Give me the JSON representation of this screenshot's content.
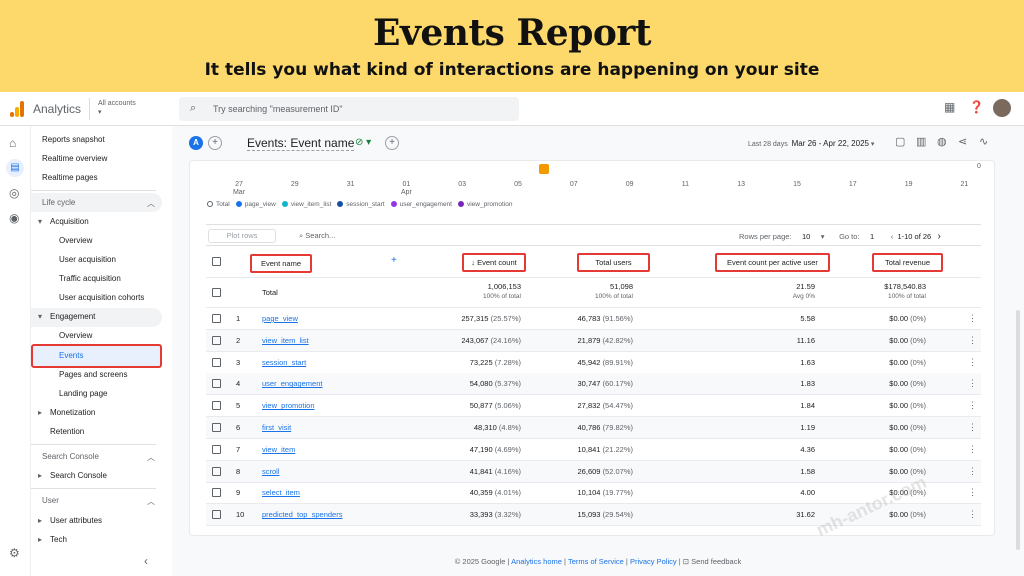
{
  "banner": {
    "title": "Events Report",
    "subtitle": "It tells you what kind of interactions are happening on your site"
  },
  "topbar": {
    "app_title": "Analytics",
    "account_label": "All accounts",
    "search_placeholder": "Try searching \"measurement ID\""
  },
  "nav": {
    "reports_snapshot": "Reports snapshot",
    "realtime_overview": "Realtime overview",
    "realtime_pages": "Realtime pages",
    "life_cycle": "Life cycle",
    "acquisition": "Acquisition",
    "acq_overview": "Overview",
    "user_acquisition": "User acquisition",
    "traffic_acquisition": "Traffic acquisition",
    "user_acq_cohorts": "User acquisition cohorts",
    "engagement": "Engagement",
    "eng_overview": "Overview",
    "events": "Events",
    "pages_screens": "Pages and screens",
    "landing_page": "Landing page",
    "monetization": "Monetization",
    "retention": "Retention",
    "search_console_sec": "Search Console",
    "search_console": "Search Console",
    "user_sec": "User",
    "user_attributes": "User attributes",
    "tech": "Tech"
  },
  "header": {
    "avatar_letter": "A",
    "title": "Events: Event name",
    "date_label": "Last 28 days",
    "date_range": "Mar 26 - Apr 22, 2025"
  },
  "chart": {
    "zero_label": "0",
    "axis": [
      {
        "d": "27",
        "m": "Mar"
      },
      {
        "d": "29",
        "m": ""
      },
      {
        "d": "31",
        "m": ""
      },
      {
        "d": "01",
        "m": "Apr"
      },
      {
        "d": "03",
        "m": ""
      },
      {
        "d": "05",
        "m": ""
      },
      {
        "d": "07",
        "m": ""
      },
      {
        "d": "09",
        "m": ""
      },
      {
        "d": "11",
        "m": ""
      },
      {
        "d": "13",
        "m": ""
      },
      {
        "d": "15",
        "m": ""
      },
      {
        "d": "17",
        "m": ""
      },
      {
        "d": "19",
        "m": ""
      },
      {
        "d": "21",
        "m": ""
      }
    ],
    "legend": [
      {
        "label": "Total",
        "color": "#ffffff"
      },
      {
        "label": "page_view",
        "color": "#1a73e8"
      },
      {
        "label": "view_item_list",
        "color": "#12b5cb"
      },
      {
        "label": "session_start",
        "color": "#174ea6"
      },
      {
        "label": "user_engagement",
        "color": "#9334e6"
      },
      {
        "label": "view_promotion",
        "color": "#7627bb"
      }
    ]
  },
  "toolbar": {
    "plot_rows": "Plot rows",
    "search": "Search...",
    "rows_per_page": "Rows per page:",
    "rows_value": "10",
    "goto": "Go to:",
    "goto_value": "1",
    "range": "1-10 of 26"
  },
  "table": {
    "headers": {
      "event_name": "Event name",
      "event_count": "Event count",
      "total_users": "Total users",
      "per_user": "Event count per active user",
      "revenue": "Total revenue"
    },
    "total": {
      "label": "Total",
      "event_count": "1,006,153",
      "event_count_sub": "100% of total",
      "users": "51,098",
      "users_sub": "100% of total",
      "per_user": "21.59",
      "per_user_sub": "Avg 0%",
      "revenue": "$178,540.83",
      "revenue_sub": "100% of total"
    },
    "rows": [
      {
        "n": "1",
        "name": "page_view",
        "count": "257,315",
        "count_pct": "(25.57%)",
        "users": "46,783",
        "users_pct": "(91.56%)",
        "per": "5.58",
        "rev": "$0.00",
        "rev_pct": "(0%)"
      },
      {
        "n": "2",
        "name": "view_item_list",
        "count": "243,067",
        "count_pct": "(24.16%)",
        "users": "21,879",
        "users_pct": "(42.82%)",
        "per": "11.16",
        "rev": "$0.00",
        "rev_pct": "(0%)"
      },
      {
        "n": "3",
        "name": "session_start",
        "count": "73,225",
        "count_pct": "(7.28%)",
        "users": "45,942",
        "users_pct": "(89.91%)",
        "per": "1.63",
        "rev": "$0.00",
        "rev_pct": "(0%)"
      },
      {
        "n": "4",
        "name": "user_engagement",
        "count": "54,080",
        "count_pct": "(5.37%)",
        "users": "30,747",
        "users_pct": "(60.17%)",
        "per": "1.83",
        "rev": "$0.00",
        "rev_pct": "(0%)"
      },
      {
        "n": "5",
        "name": "view_promotion",
        "count": "50,877",
        "count_pct": "(5.06%)",
        "users": "27,832",
        "users_pct": "(54.47%)",
        "per": "1.84",
        "rev": "$0.00",
        "rev_pct": "(0%)"
      },
      {
        "n": "6",
        "name": "first_visit",
        "count": "48,310",
        "count_pct": "(4.8%)",
        "users": "40,786",
        "users_pct": "(79.82%)",
        "per": "1.19",
        "rev": "$0.00",
        "rev_pct": "(0%)"
      },
      {
        "n": "7",
        "name": "view_item",
        "count": "47,190",
        "count_pct": "(4.69%)",
        "users": "10,841",
        "users_pct": "(21.22%)",
        "per": "4.36",
        "rev": "$0.00",
        "rev_pct": "(0%)"
      },
      {
        "n": "8",
        "name": "scroll",
        "count": "41,841",
        "count_pct": "(4.16%)",
        "users": "26,609",
        "users_pct": "(52.07%)",
        "per": "1.58",
        "rev": "$0.00",
        "rev_pct": "(0%)"
      },
      {
        "n": "9",
        "name": "select_item",
        "count": "40,359",
        "count_pct": "(4.01%)",
        "users": "10,104",
        "users_pct": "(19.77%)",
        "per": "4.00",
        "rev": "$0.00",
        "rev_pct": "(0%)"
      },
      {
        "n": "10",
        "name": "predicted_top_spenders",
        "count": "33,393",
        "count_pct": "(3.32%)",
        "users": "15,093",
        "users_pct": "(29.54%)",
        "per": "31.62",
        "rev": "$0.00",
        "rev_pct": "(0%)"
      }
    ]
  },
  "footer": {
    "copyright": "© 2025 Google |",
    "home": "Analytics home",
    "sep1": "|",
    "terms": "Terms of Service",
    "sep2": "|",
    "privacy": "Privacy Policy",
    "sep3": "|",
    "feedback": "Send feedback"
  },
  "watermark": "mh-antor.com"
}
